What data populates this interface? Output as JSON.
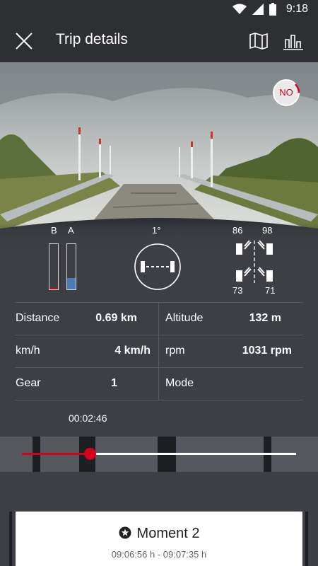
{
  "status_bar": {
    "time": "9:18"
  },
  "app_bar": {
    "title": "Trip details"
  },
  "camera": {
    "drive_mode_badge": "NO"
  },
  "telemetry": {
    "bar_b_label": "B",
    "bar_a_label": "A",
    "bar_b_level": 0.03,
    "bar_a_level": 0.25,
    "tilt": "1°",
    "tire_fl": "86",
    "tire_fr": "98",
    "tire_rl": "73",
    "tire_rr": "71"
  },
  "stats": {
    "distance_label": "Distance",
    "distance_value": "0.69 km",
    "altitude_label": "Altitude",
    "altitude_value": "132 m",
    "speed_label": "km/h",
    "speed_value": "4 km/h",
    "rpm_label": "rpm",
    "rpm_value": "1031 rpm",
    "gear_label": "Gear",
    "gear_value": "1",
    "mode_label": "Mode",
    "mode_value": ""
  },
  "playback": {
    "elapsed": "00:02:46",
    "progress": 0.25
  },
  "moment": {
    "title": "Moment 2",
    "time_range": "09:06:56 h - 09:07:35 h"
  },
  "colors": {
    "accent": "#d5001c",
    "background": "#3d3f44",
    "bar_a": "#4a7ab8"
  }
}
